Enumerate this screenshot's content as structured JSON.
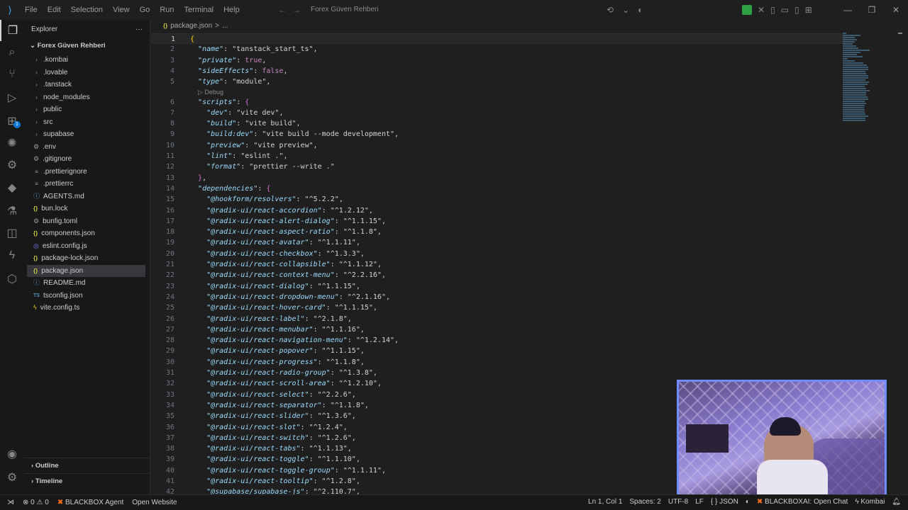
{
  "menu": [
    "File",
    "Edit",
    "Selection",
    "View",
    "Go",
    "Run",
    "Terminal",
    "Help"
  ],
  "command_center": "Forex Güven Rehberi",
  "explorer": {
    "title": "Explorer",
    "more": "···",
    "root": "Forex Güven Rehberi",
    "items": [
      {
        "label": ".kombai",
        "kind": "folder"
      },
      {
        "label": ".lovable",
        "kind": "folder"
      },
      {
        "label": ".tanstack",
        "kind": "folder"
      },
      {
        "label": "node_modules",
        "kind": "folder"
      },
      {
        "label": "public",
        "kind": "folder"
      },
      {
        "label": "src",
        "kind": "folder"
      },
      {
        "label": "supabase",
        "kind": "folder"
      },
      {
        "label": ".env",
        "kind": "gear"
      },
      {
        "label": ".gitignore",
        "kind": "gear"
      },
      {
        "label": ".prettierignore",
        "kind": "file"
      },
      {
        "label": ".prettierrc",
        "kind": "file"
      },
      {
        "label": "AGENTS.md",
        "kind": "md"
      },
      {
        "label": "bun.lock",
        "kind": "json"
      },
      {
        "label": "bunfig.toml",
        "kind": "gear"
      },
      {
        "label": "components.json",
        "kind": "json"
      },
      {
        "label": "eslint.config.js",
        "kind": "eslint"
      },
      {
        "label": "package-lock.json",
        "kind": "json"
      },
      {
        "label": "package.json",
        "kind": "json"
      },
      {
        "label": "README.md",
        "kind": "md"
      },
      {
        "label": "tsconfig.json",
        "kind": "ts"
      },
      {
        "label": "vite.config.ts",
        "kind": "vite"
      }
    ],
    "selected_index": 17,
    "outline": "Outline",
    "timeline": "Timeline"
  },
  "breadcrumb": {
    "file": "package.json",
    "sep": ">",
    "rest": "..."
  },
  "codelens": "▷ Debug",
  "code": [
    {
      "n": "1",
      "parts": [
        [
          "brace",
          "{"
        ]
      ]
    },
    {
      "n": "2",
      "parts": [
        [
          "val",
          "  "
        ],
        [
          "key",
          "\"name\""
        ],
        [
          "val",
          ": \"tanstack_start_ts\","
        ]
      ]
    },
    {
      "n": "3",
      "parts": [
        [
          "val",
          "  "
        ],
        [
          "key",
          "\"private\""
        ],
        [
          "val",
          ": "
        ],
        [
          "bool",
          "true"
        ],
        [
          "val",
          ","
        ]
      ]
    },
    {
      "n": "4",
      "parts": [
        [
          "val",
          "  "
        ],
        [
          "key",
          "\"sideEffects\""
        ],
        [
          "val",
          ": "
        ],
        [
          "bool",
          "false"
        ],
        [
          "val",
          ","
        ]
      ]
    },
    {
      "n": "5",
      "parts": [
        [
          "val",
          "  "
        ],
        [
          "key",
          "\"type\""
        ],
        [
          "val",
          ": \"module\","
        ]
      ]
    },
    {
      "n": "6",
      "parts": [
        [
          "val",
          "  "
        ],
        [
          "key",
          "\"scripts\""
        ],
        [
          "val",
          ": "
        ],
        [
          "brace2",
          "{"
        ]
      ]
    },
    {
      "n": "7",
      "parts": [
        [
          "val",
          "    "
        ],
        [
          "key",
          "\"dev\""
        ],
        [
          "val",
          ": \"vite dev\","
        ]
      ]
    },
    {
      "n": "8",
      "parts": [
        [
          "val",
          "    "
        ],
        [
          "key",
          "\"build\""
        ],
        [
          "val",
          ": \"vite build\","
        ]
      ]
    },
    {
      "n": "9",
      "parts": [
        [
          "val",
          "    "
        ],
        [
          "key",
          "\"build:dev\""
        ],
        [
          "val",
          ": \"vite build --mode development\","
        ]
      ]
    },
    {
      "n": "10",
      "parts": [
        [
          "val",
          "    "
        ],
        [
          "key",
          "\"preview\""
        ],
        [
          "val",
          ": \"vite preview\","
        ]
      ]
    },
    {
      "n": "11",
      "parts": [
        [
          "val",
          "    "
        ],
        [
          "key",
          "\"lint\""
        ],
        [
          "val",
          ": \"eslint .\","
        ]
      ]
    },
    {
      "n": "12",
      "parts": [
        [
          "val",
          "    "
        ],
        [
          "key",
          "\"format\""
        ],
        [
          "val",
          ": \"prettier --write .\""
        ]
      ]
    },
    {
      "n": "13",
      "parts": [
        [
          "val",
          "  "
        ],
        [
          "brace2",
          "}"
        ],
        [
          "val",
          ","
        ]
      ]
    },
    {
      "n": "14",
      "parts": [
        [
          "val",
          "  "
        ],
        [
          "key",
          "\"dependencies\""
        ],
        [
          "val",
          ": "
        ],
        [
          "brace2",
          "{"
        ]
      ]
    },
    {
      "n": "15",
      "parts": [
        [
          "val",
          "    "
        ],
        [
          "key",
          "\"@hookform/resolvers\""
        ],
        [
          "val",
          ": \"^5.2.2\","
        ]
      ]
    },
    {
      "n": "16",
      "parts": [
        [
          "val",
          "    "
        ],
        [
          "key",
          "\"@radix-ui/react-accordion\""
        ],
        [
          "val",
          ": \"^1.2.12\","
        ]
      ]
    },
    {
      "n": "17",
      "parts": [
        [
          "val",
          "    "
        ],
        [
          "key",
          "\"@radix-ui/react-alert-dialog\""
        ],
        [
          "val",
          ": \"^1.1.15\","
        ]
      ]
    },
    {
      "n": "18",
      "parts": [
        [
          "val",
          "    "
        ],
        [
          "key",
          "\"@radix-ui/react-aspect-ratio\""
        ],
        [
          "val",
          ": \"^1.1.8\","
        ]
      ]
    },
    {
      "n": "19",
      "parts": [
        [
          "val",
          "    "
        ],
        [
          "key",
          "\"@radix-ui/react-avatar\""
        ],
        [
          "val",
          ": \"^1.1.11\","
        ]
      ]
    },
    {
      "n": "20",
      "parts": [
        [
          "val",
          "    "
        ],
        [
          "key",
          "\"@radix-ui/react-checkbox\""
        ],
        [
          "val",
          ": \"^1.3.3\","
        ]
      ]
    },
    {
      "n": "21",
      "parts": [
        [
          "val",
          "    "
        ],
        [
          "key",
          "\"@radix-ui/react-collapsible\""
        ],
        [
          "val",
          ": \"^1.1.12\","
        ]
      ]
    },
    {
      "n": "22",
      "parts": [
        [
          "val",
          "    "
        ],
        [
          "key",
          "\"@radix-ui/react-context-menu\""
        ],
        [
          "val",
          ": \"^2.2.16\","
        ]
      ]
    },
    {
      "n": "23",
      "parts": [
        [
          "val",
          "    "
        ],
        [
          "key",
          "\"@radix-ui/react-dialog\""
        ],
        [
          "val",
          ": \"^1.1.15\","
        ]
      ]
    },
    {
      "n": "24",
      "parts": [
        [
          "val",
          "    "
        ],
        [
          "key",
          "\"@radix-ui/react-dropdown-menu\""
        ],
        [
          "val",
          ": \"^2.1.16\","
        ]
      ]
    },
    {
      "n": "25",
      "parts": [
        [
          "val",
          "    "
        ],
        [
          "key",
          "\"@radix-ui/react-hover-card\""
        ],
        [
          "val",
          ": \"^1.1.15\","
        ]
      ]
    },
    {
      "n": "26",
      "parts": [
        [
          "val",
          "    "
        ],
        [
          "key",
          "\"@radix-ui/react-label\""
        ],
        [
          "val",
          ": \"^2.1.8\","
        ]
      ]
    },
    {
      "n": "27",
      "parts": [
        [
          "val",
          "    "
        ],
        [
          "key",
          "\"@radix-ui/react-menubar\""
        ],
        [
          "val",
          ": \"^1.1.16\","
        ]
      ]
    },
    {
      "n": "28",
      "parts": [
        [
          "val",
          "    "
        ],
        [
          "key",
          "\"@radix-ui/react-navigation-menu\""
        ],
        [
          "val",
          ": \"^1.2.14\","
        ]
      ]
    },
    {
      "n": "29",
      "parts": [
        [
          "val",
          "    "
        ],
        [
          "key",
          "\"@radix-ui/react-popover\""
        ],
        [
          "val",
          ": \"^1.1.15\","
        ]
      ]
    },
    {
      "n": "30",
      "parts": [
        [
          "val",
          "    "
        ],
        [
          "key",
          "\"@radix-ui/react-progress\""
        ],
        [
          "val",
          ": \"^1.1.8\","
        ]
      ]
    },
    {
      "n": "31",
      "parts": [
        [
          "val",
          "    "
        ],
        [
          "key",
          "\"@radix-ui/react-radio-group\""
        ],
        [
          "val",
          ": \"^1.3.8\","
        ]
      ]
    },
    {
      "n": "32",
      "parts": [
        [
          "val",
          "    "
        ],
        [
          "key",
          "\"@radix-ui/react-scroll-area\""
        ],
        [
          "val",
          ": \"^1.2.10\","
        ]
      ]
    },
    {
      "n": "33",
      "parts": [
        [
          "val",
          "    "
        ],
        [
          "key",
          "\"@radix-ui/react-select\""
        ],
        [
          "val",
          ": \"^2.2.6\","
        ]
      ]
    },
    {
      "n": "34",
      "parts": [
        [
          "val",
          "    "
        ],
        [
          "key",
          "\"@radix-ui/react-separator\""
        ],
        [
          "val",
          ": \"^1.1.8\","
        ]
      ]
    },
    {
      "n": "35",
      "parts": [
        [
          "val",
          "    "
        ],
        [
          "key",
          "\"@radix-ui/react-slider\""
        ],
        [
          "val",
          ": \"^1.3.6\","
        ]
      ]
    },
    {
      "n": "36",
      "parts": [
        [
          "val",
          "    "
        ],
        [
          "key",
          "\"@radix-ui/react-slot\""
        ],
        [
          "val",
          ": \"^1.2.4\","
        ]
      ]
    },
    {
      "n": "37",
      "parts": [
        [
          "val",
          "    "
        ],
        [
          "key",
          "\"@radix-ui/react-switch\""
        ],
        [
          "val",
          ": \"^1.2.6\","
        ]
      ]
    },
    {
      "n": "38",
      "parts": [
        [
          "val",
          "    "
        ],
        [
          "key",
          "\"@radix-ui/react-tabs\""
        ],
        [
          "val",
          ": \"^1.1.13\","
        ]
      ]
    },
    {
      "n": "39",
      "parts": [
        [
          "val",
          "    "
        ],
        [
          "key",
          "\"@radix-ui/react-toggle\""
        ],
        [
          "val",
          ": \"^1.1.10\","
        ]
      ]
    },
    {
      "n": "40",
      "parts": [
        [
          "val",
          "    "
        ],
        [
          "key",
          "\"@radix-ui/react-toggle-group\""
        ],
        [
          "val",
          ": \"^1.1.11\","
        ]
      ]
    },
    {
      "n": "41",
      "parts": [
        [
          "val",
          "    "
        ],
        [
          "key",
          "\"@radix-ui/react-tooltip\""
        ],
        [
          "val",
          ": \"^1.2.8\","
        ]
      ]
    },
    {
      "n": "42",
      "parts": [
        [
          "val",
          "    "
        ],
        [
          "key",
          "\"@supabase/supabase-js\""
        ],
        [
          "val",
          ": \"^2.110.7\","
        ]
      ]
    }
  ],
  "status": {
    "errors": "0",
    "warnings": "0",
    "agent": "BLACKBOX Agent",
    "open_website": "Open Website",
    "position": "Ln 1, Col 1",
    "spaces": "Spaces: 2",
    "encoding": "UTF-8",
    "eol": "LF",
    "language": "JSON",
    "blackbox_chat": "BLACKBOXAI: Open Chat",
    "kombai": "Kombai"
  },
  "colors": {
    "accent": "#0e78d4",
    "selection": "#37373d",
    "key": "#9cdcfe",
    "keyword": "#c586c0"
  }
}
